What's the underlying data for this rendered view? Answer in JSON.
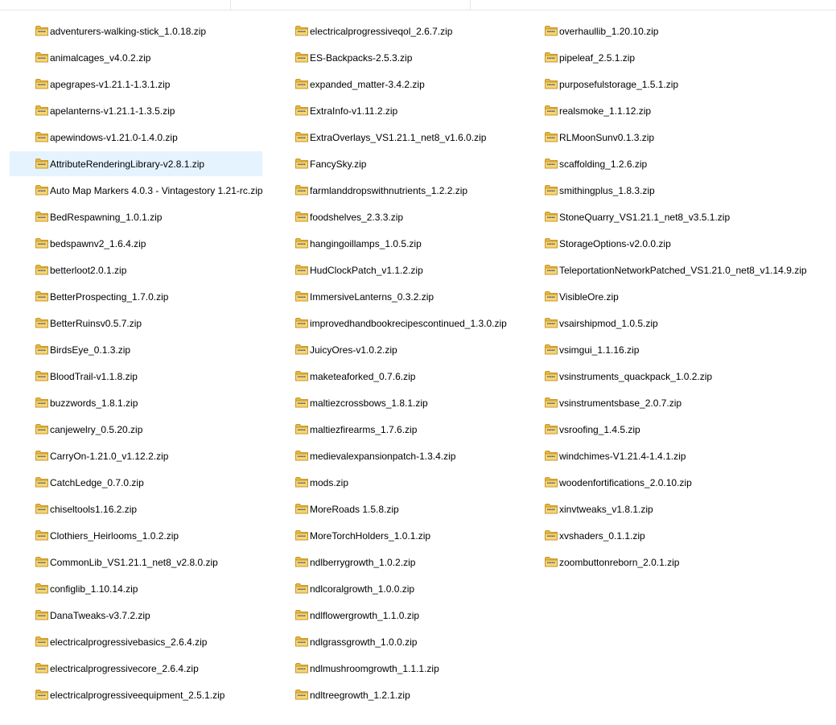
{
  "columns": [
    {
      "items": [
        "adventurers-walking-stick_1.0.18.zip",
        "animalcages_v4.0.2.zip",
        "apegrapes-v1.21.1-1.3.1.zip",
        "apelanterns-v1.21.1-1.3.5.zip",
        "apewindows-v1.21.0-1.4.0.zip",
        "AttributeRenderingLibrary-v2.8.1.zip",
        "Auto Map Markers 4.0.3 - Vintagestory 1.21-rc.zip",
        "BedRespawning_1.0.1.zip",
        "bedspawnv2_1.6.4.zip",
        "betterloot2.0.1.zip",
        "BetterProspecting_1.7.0.zip",
        "BetterRuinsv0.5.7.zip",
        "BirdsEye_0.1.3.zip",
        "BloodTrail-v1.1.8.zip",
        "buzzwords_1.8.1.zip",
        "canjewelry_0.5.20.zip",
        "CarryOn-1.21.0_v1.12.2.zip",
        "CatchLedge_0.7.0.zip",
        "chiseltools1.16.2.zip",
        "Clothiers_Heirlooms_1.0.2.zip",
        "CommonLib_VS1.21.1_net8_v2.8.0.zip",
        "configlib_1.10.14.zip",
        "DanaTweaks-v3.7.2.zip",
        "electricalprogressivebasics_2.6.4.zip",
        "electricalprogressivecore_2.6.4.zip",
        "electricalprogressiveequipment_2.5.1.zip"
      ]
    },
    {
      "items": [
        "electricalprogressiveqol_2.6.7.zip",
        "ES-Backpacks-2.5.3.zip",
        "expanded_matter-3.4.2.zip",
        "ExtraInfo-v1.11.2.zip",
        "ExtraOverlays_VS1.21.1_net8_v1.6.0.zip",
        "FancySky.zip",
        "farmlanddropswithnutrients_1.2.2.zip",
        "foodshelves_2.3.3.zip",
        "hangingoillamps_1.0.5.zip",
        "HudClockPatch_v1.1.2.zip",
        "ImmersiveLanterns_0.3.2.zip",
        "improvedhandbookrecipescontinued_1.3.0.zip",
        "JuicyOres-v1.0.2.zip",
        "maketeaforked_0.7.6.zip",
        "maltiezcrossbows_1.8.1.zip",
        "maltiezfirearms_1.7.6.zip",
        "medievalexpansionpatch-1.3.4.zip",
        "mods.zip",
        "MoreRoads 1.5.8.zip",
        "MoreTorchHolders_1.0.1.zip",
        "ndlberrygrowth_1.0.2.zip",
        "ndlcoralgrowth_1.0.0.zip",
        "ndlflowergrowth_1.1.0.zip",
        "ndlgrassgrowth_1.0.0.zip",
        "ndlmushroomgrowth_1.1.1.zip",
        "ndltreegrowth_1.2.1.zip"
      ]
    },
    {
      "items": [
        "overhaullib_1.20.10.zip",
        "pipeleaf_2.5.1.zip",
        "purposefulstorage_1.5.1.zip",
        "realsmoke_1.1.12.zip",
        "RLMoonSunv0.1.3.zip",
        "scaffolding_1.2.6.zip",
        "smithingplus_1.8.3.zip",
        "StoneQuarry_VS1.21.1_net8_v3.5.1.zip",
        "StorageOptions-v2.0.0.zip",
        "TeleportationNetworkPatched_VS1.21.0_net8_v1.14.9.zip",
        "VisibleOre.zip",
        "vsairshipmod_1.0.5.zip",
        "vsimgui_1.1.16.zip",
        "vsinstruments_quackpack_1.0.2.zip",
        "vsinstrumentsbase_2.0.7.zip",
        "vsroofing_1.4.5.zip",
        "windchimes-V1.21.4-1.4.1.zip",
        "woodenfortifications_2.0.10.zip",
        "xinvtweaks_v1.8.1.zip",
        "xvshaders_0.1.1.zip",
        "zoombuttonreborn_2.0.1.zip"
      ]
    }
  ],
  "selected": "AttributeRenderingLibrary-v2.8.1.zip",
  "icon": "zip-folder-icon",
  "colors": {
    "selection": "#e5f3ff",
    "folder": "#f0c850",
    "zipper": "#7a7a7a"
  }
}
